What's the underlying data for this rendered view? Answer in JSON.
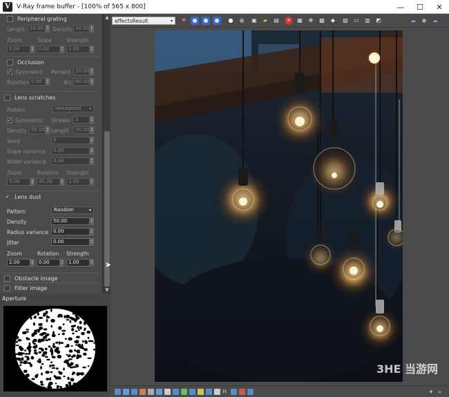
{
  "window": {
    "icon_glyph": "V",
    "title": "V-Ray frame buffer - [100% of 565 x 800]",
    "minimize": "—",
    "maximize": "☐",
    "close": "✕"
  },
  "sections": {
    "peripheral_grating": {
      "label": "Peripheral grating",
      "length_label": "Length",
      "length_value": "20.00",
      "density_label": "Density",
      "density_value": "20.00",
      "zoom_label": "Zoom",
      "zoom_value": "5.00",
      "slope_label": "Slope",
      "slope_value": "0.00",
      "strength_label": "Strength",
      "strength_value": "1.00"
    },
    "occlusion": {
      "label": "Occlusion",
      "symmetric_label": "Symmetric",
      "percent_label": "Percent",
      "percent_value": "20.00",
      "rotation_label": "Rotation",
      "rotation_value": "0.00",
      "arc_label": "Arc",
      "arc_value": "60.00"
    },
    "lens_scratches": {
      "label": "Lens scratches",
      "pattern_label": "Pattern",
      "pattern_value": "Hexagonal",
      "symmetric_label": "Symmetric",
      "streaks_label": "Streaks",
      "streaks_value": "3",
      "density_label": "Density",
      "density_value": "50.00",
      "length_label": "Length",
      "length_value": "30.00",
      "seed_label": "Seed",
      "seed_value": "0",
      "slope_variance_label": "Slope variance",
      "slope_variance_value": "0.00",
      "width_variance_label": "Width variance",
      "width_variance_value": "0.00",
      "zoom_label": "Zoom",
      "zoom_value": "5.00",
      "rotation_label": "Rotation",
      "rotation_value": "45.00",
      "strength_label": "Strength",
      "strength_value": "1.00"
    },
    "lens_dust": {
      "label": "Lens dust",
      "pattern_label": "Pattern",
      "pattern_value": "Random",
      "density_label": "Density",
      "density_value": "50.00",
      "radius_variance_label": "Radius variance",
      "radius_variance_value": "0.00",
      "jitter_label": "Jitter",
      "jitter_value": "0.00",
      "zoom_label": "Zoom",
      "zoom_value": "2.00",
      "rotation_label": "Rotation",
      "rotation_value": "0.00",
      "strength_label": "Strength",
      "strength_value": "1.00"
    },
    "obstacle_image": {
      "label": "Obstacle image"
    },
    "filter_image": {
      "label": "Filter image"
    }
  },
  "aperture": {
    "label": "Aperture"
  },
  "toolbar": {
    "channel": "effectsResult"
  },
  "watermark": "3HE 当游网",
  "colors": {
    "accent_blue": "#3a66c4",
    "accent_red": "#c23a3a",
    "panel_bg": "#4a4a4a"
  }
}
